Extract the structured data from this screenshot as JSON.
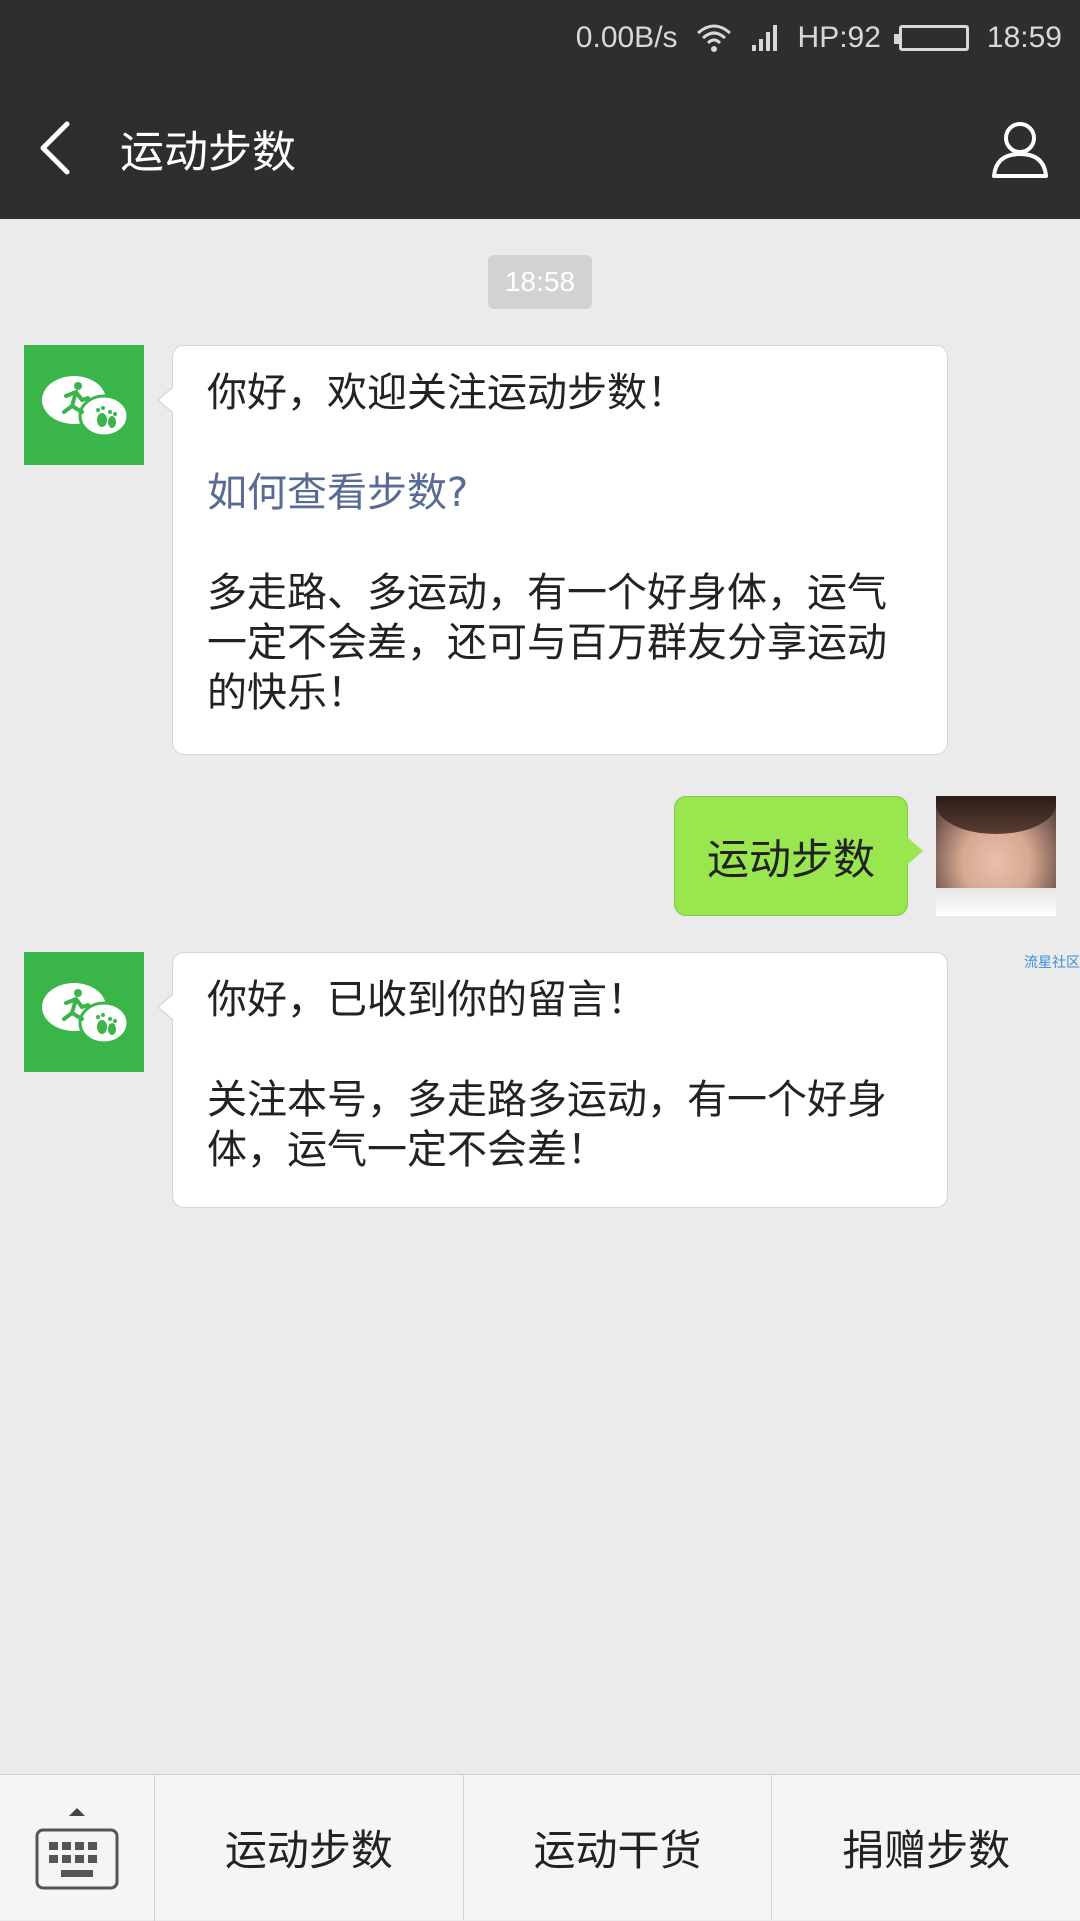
{
  "status_bar": {
    "net_speed": "0.00B/s",
    "carrier": "HP:92",
    "time": "18:59",
    "battery_level": 0.92,
    "icons": [
      "wifi-icon",
      "signal-icon",
      "battery-icon"
    ]
  },
  "nav": {
    "title": "运动步数",
    "back_icon": "chevron-left-icon",
    "profile_icon": "person-icon"
  },
  "chat": {
    "timestamp": "18:58",
    "messages": [
      {
        "from": "bot",
        "line1": "你好，欢迎关注运动步数！",
        "link": "如何查看步数?",
        "line3": "多走路、多运动，有一个好身体，运气一定不会差，还可与百万群友分享运动的快乐！"
      },
      {
        "from": "user",
        "text": "运动步数"
      },
      {
        "from": "bot",
        "line1": "你好，已收到你的留言！",
        "line2": "关注本号，多走路多运动，有一个好身体，运气一定不会差！"
      }
    ],
    "watermark": "流星社区"
  },
  "bottom_menu": {
    "keyboard_icon": "keyboard-icon",
    "items": [
      "运动步数",
      "运动干货",
      "捐赠步数"
    ]
  },
  "colors": {
    "nav_bg": "#2e2e2e",
    "chat_bg": "#ebebeb",
    "bot_avatar": "#3ab54a",
    "user_bubble": "#9ae64f",
    "link": "#576b95"
  }
}
